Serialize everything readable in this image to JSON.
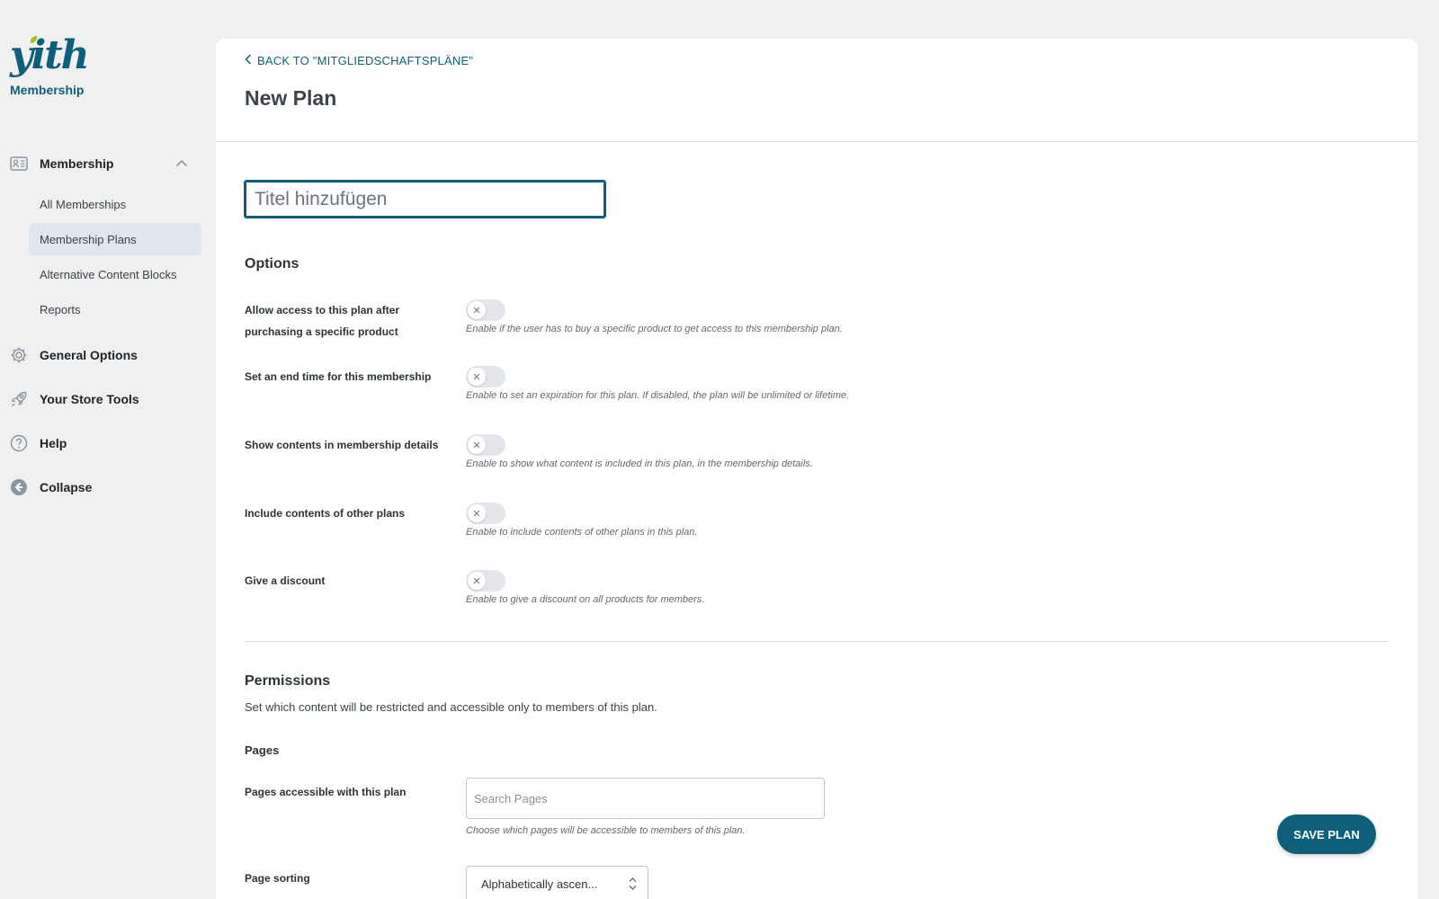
{
  "brand": {
    "logo_text": "yith",
    "subtitle": "Membership"
  },
  "sidebar": {
    "group": {
      "label": "Membership",
      "icon": "id-card-icon",
      "expanded": true
    },
    "sub_items": [
      {
        "label": "All Memberships",
        "active": false
      },
      {
        "label": "Membership Plans",
        "active": true
      },
      {
        "label": "Alternative Content Blocks",
        "active": false
      },
      {
        "label": "Reports",
        "active": false
      }
    ],
    "items": [
      {
        "label": "General Options",
        "icon": "gear-icon"
      },
      {
        "label": "Your Store Tools",
        "icon": "rocket-icon"
      },
      {
        "label": "Help",
        "icon": "help-icon"
      },
      {
        "label": "Collapse",
        "icon": "collapse-icon"
      }
    ]
  },
  "header": {
    "back_label": "BACK TO \"MITGLIEDSCHAFTSPLÄNE\"",
    "title": "New Plan"
  },
  "form": {
    "title_placeholder": "Titel hinzufügen",
    "title_value": ""
  },
  "options": {
    "heading": "Options",
    "rows": [
      {
        "label": "Allow access to this plan after purchasing a specific product",
        "enabled": false,
        "description": "Enable if the user has to buy a specific product to get access to this membership plan."
      },
      {
        "label": "Set an end time for this membership",
        "enabled": false,
        "description": "Enable to set an expiration for this plan. If disabled, the plan will be unlimited or lifetime."
      },
      {
        "label": "Show contents in membership details",
        "enabled": false,
        "description": "Enable to show what content is included in this plan, in the membership details."
      },
      {
        "label": "Include contents of other plans",
        "enabled": false,
        "description": "Enable to include contents of other plans in this plan."
      },
      {
        "label": "Give a discount",
        "enabled": false,
        "description": "Enable to give a discount on all products for members."
      }
    ]
  },
  "permissions": {
    "heading": "Permissions",
    "description": "Set which content will be restricted and accessible only to members of this plan.",
    "pages_heading": "Pages",
    "pages_label": "Pages accessible with this plan",
    "pages_placeholder": "Search Pages",
    "pages_description": "Choose which pages will be accessible to members of this plan.",
    "sorting_label": "Page sorting",
    "sorting_value": "Alphabetically ascen..."
  },
  "actions": {
    "save_label": "SAVE PLAN"
  },
  "colors": {
    "accent": "#0e5f79",
    "brand_leaf": "#a5c31d",
    "active_bg": "#dfe6ec"
  }
}
